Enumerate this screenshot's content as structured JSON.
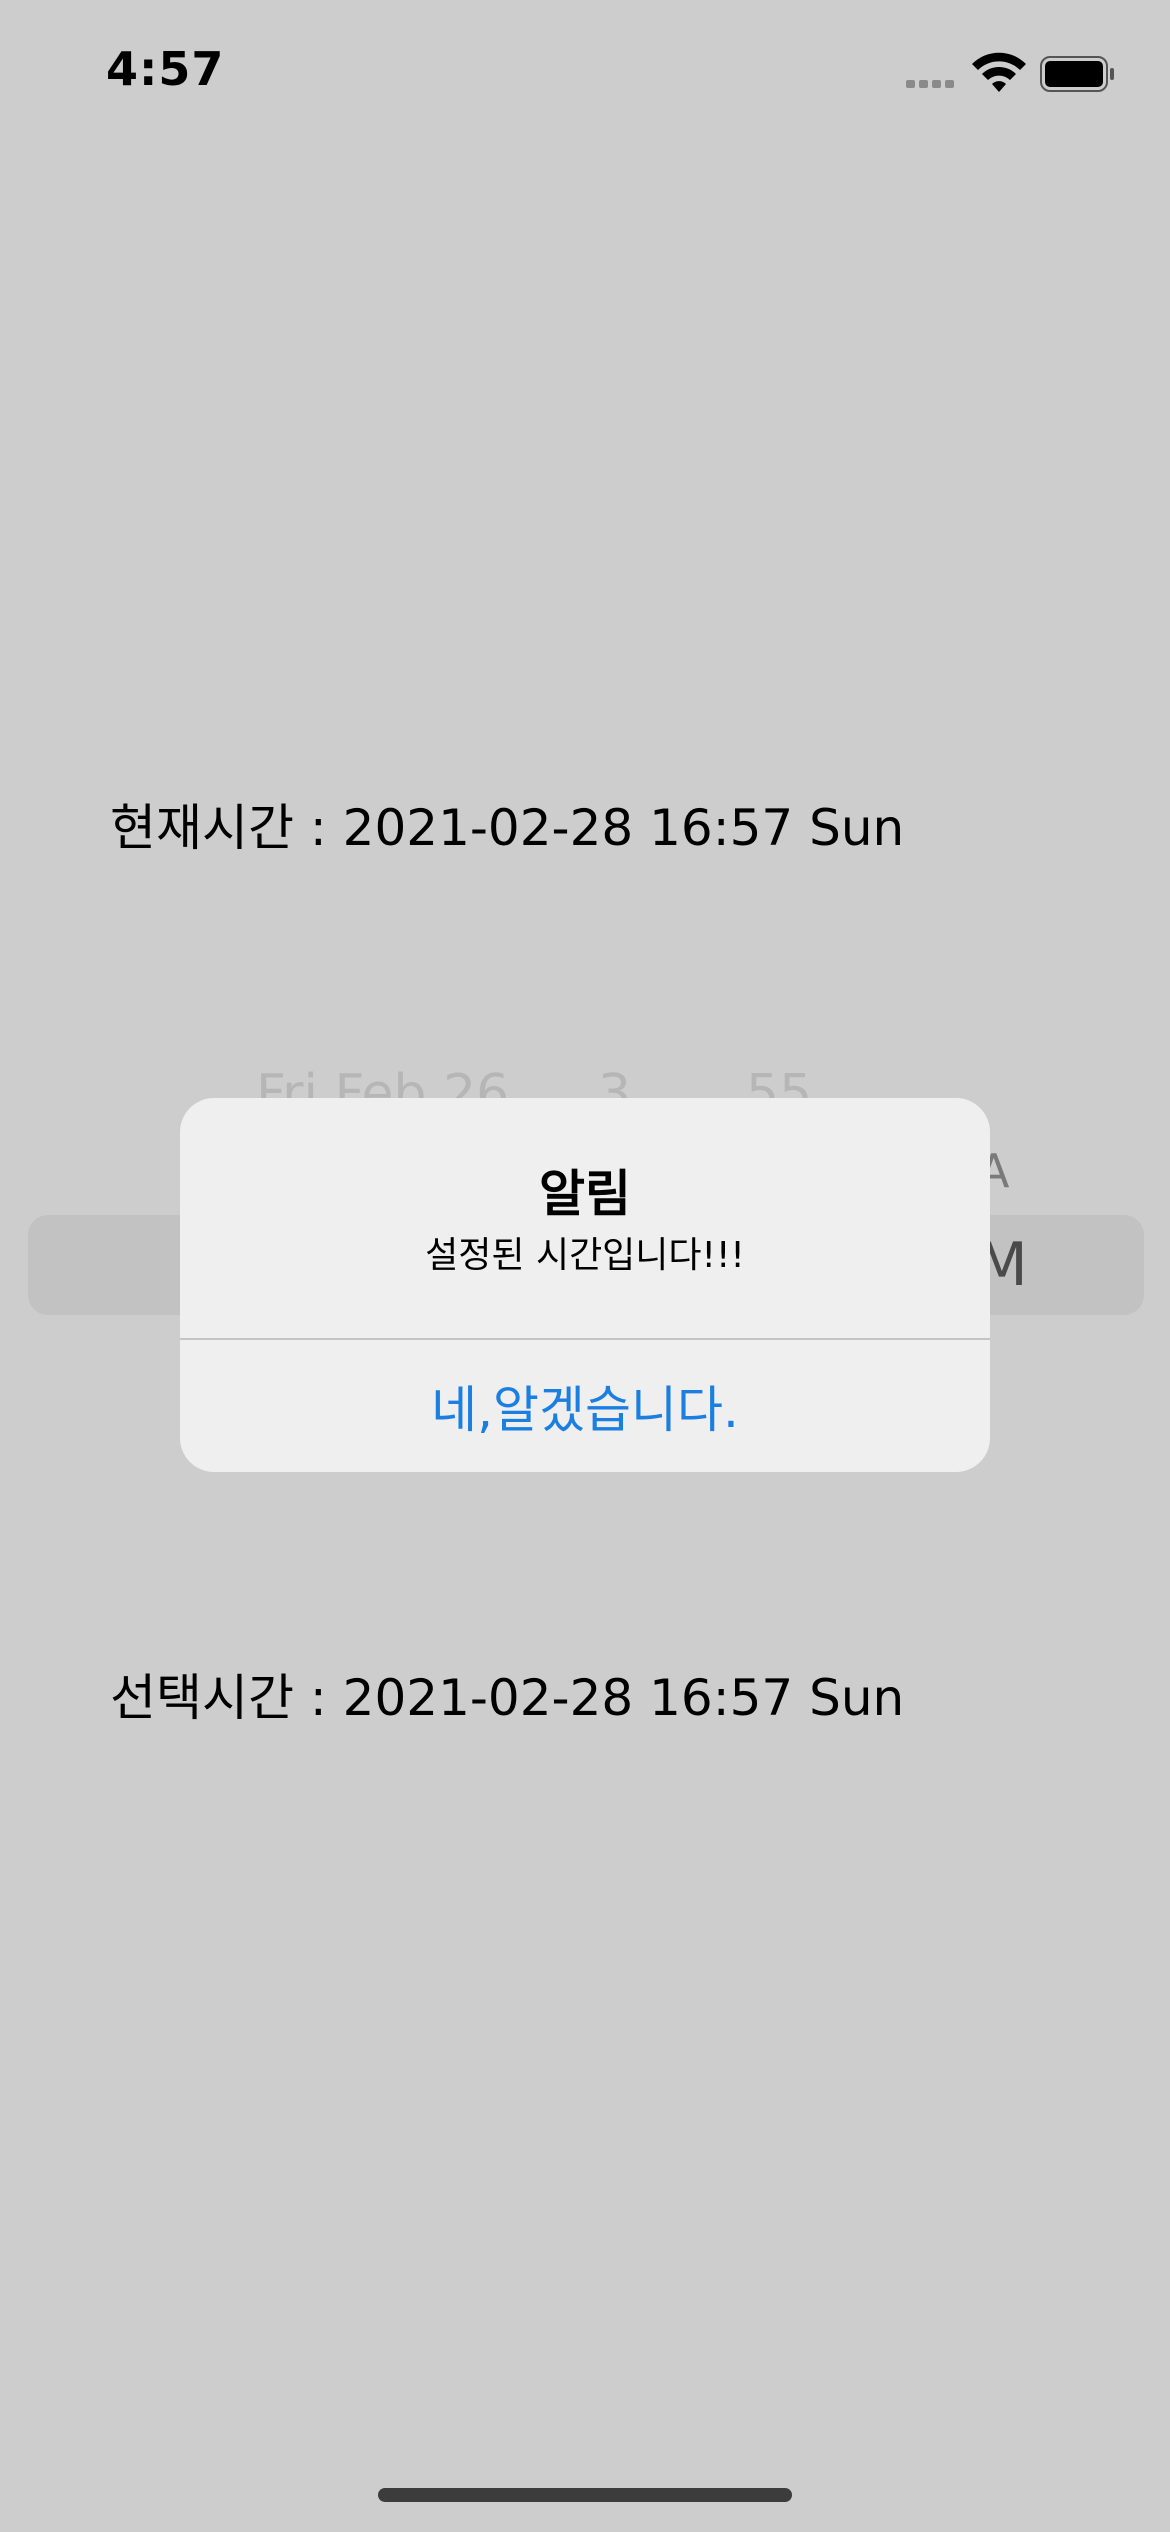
{
  "status_bar": {
    "time": "4:57",
    "signal_icon": "cellular-signal-icon",
    "wifi_icon": "wifi-icon",
    "battery_icon": "battery-icon"
  },
  "main": {
    "current_time_label": "현재시간 : 2021-02-28 16:57 Sun",
    "selected_time_label": "선택시간 : 2021-02-28 16:57 Sun"
  },
  "date_picker": {
    "visible_top_date": "Fri Feb 26",
    "visible_top_hour": "3",
    "visible_top_minute": "55",
    "edge_glyph_upper": "A",
    "edge_glyph_selected": "M"
  },
  "alert": {
    "title": "알림",
    "message": "설정된 시간입니다!!!",
    "button_label": "네,알겠습니다.",
    "button_color": "#1a7fe0"
  },
  "colors": {
    "background": "#cdcdcd",
    "alert_background": "#efefef"
  }
}
